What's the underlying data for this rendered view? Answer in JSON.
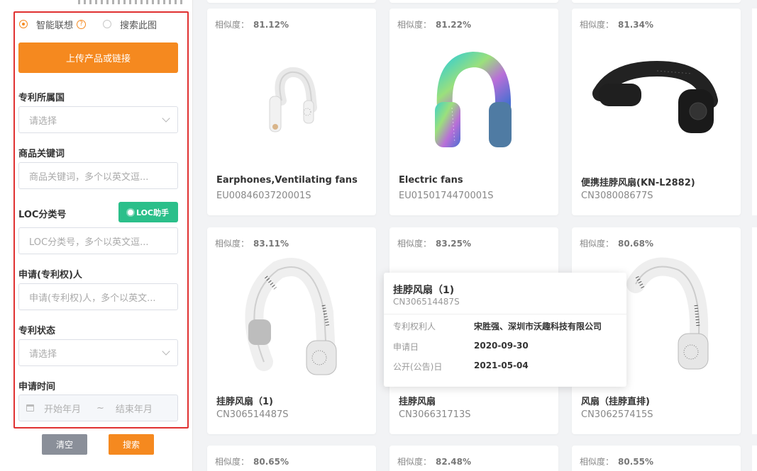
{
  "search_mode": {
    "smart_label": "智能联想",
    "image_label": "搜索此图",
    "selected": "smart"
  },
  "upload_button": "上传产品或链接",
  "fields": {
    "country_label": "专利所属国",
    "country_placeholder": "请选择",
    "keyword_label": "商品关键词",
    "keyword_placeholder": "商品关键词，多个以英文逗...",
    "loc_label": "LOC分类号",
    "loc_helper": "LOC助手",
    "loc_placeholder": "LOC分类号，多个以英文逗...",
    "applicant_label": "申请(专利权)人",
    "applicant_placeholder": "申请(专利权)人，多个以英文...",
    "status_label": "专利状态",
    "status_placeholder": "请选择",
    "date_label": "申请时间",
    "date_start": "开始年月",
    "date_sep": "~",
    "date_end": "结束年月"
  },
  "actions": {
    "clear": "清空",
    "search": "搜索"
  },
  "colors": {
    "accent": "#f5891f",
    "loc_green": "#2bbf8a",
    "highlight_red": "#e03131",
    "clear_gray": "#8a8f99"
  },
  "similarity_label": "相似度：",
  "results": [
    {
      "similarity": "81.12%",
      "title": "Earphones,Ventilating fans",
      "code": "EU0084603720001S",
      "image": "white-neck-fan-small"
    },
    {
      "similarity": "81.22%",
      "title": "Electric fans",
      "code": "EU0150174470001S",
      "image": "iridescent-neck-fan"
    },
    {
      "similarity": "81.34%",
      "title": "便携挂脖风扇(KN-L2882)",
      "code": "CN308008677S",
      "image": "black-neck-fan"
    },
    {
      "similarity": "83.11%",
      "title": "挂脖风扇（1)",
      "code": "CN306514487S",
      "image": "white-neck-fan-large"
    },
    {
      "similarity": "83.25%",
      "title": "挂脖风扇",
      "code": "CN306631713S",
      "image": "neck-fan-hidden"
    },
    {
      "similarity": "80.68%",
      "title": "风扇（挂脖直排)",
      "code": "CN306257415S",
      "image": "white-neck-fan-right"
    },
    {
      "similarity": "80.65%"
    },
    {
      "similarity": "82.48%"
    },
    {
      "similarity": "80.55%"
    }
  ],
  "tooltip": {
    "title": "挂脖风扇（1)",
    "code": "CN306514487S",
    "rows": [
      {
        "label": "专利权利人",
        "value": "宋胜强、深圳市沃趣科技有限公司"
      },
      {
        "label": "申请日",
        "value": "2020-09-30"
      },
      {
        "label": "公开(公告)日",
        "value": "2021-05-04"
      }
    ]
  }
}
